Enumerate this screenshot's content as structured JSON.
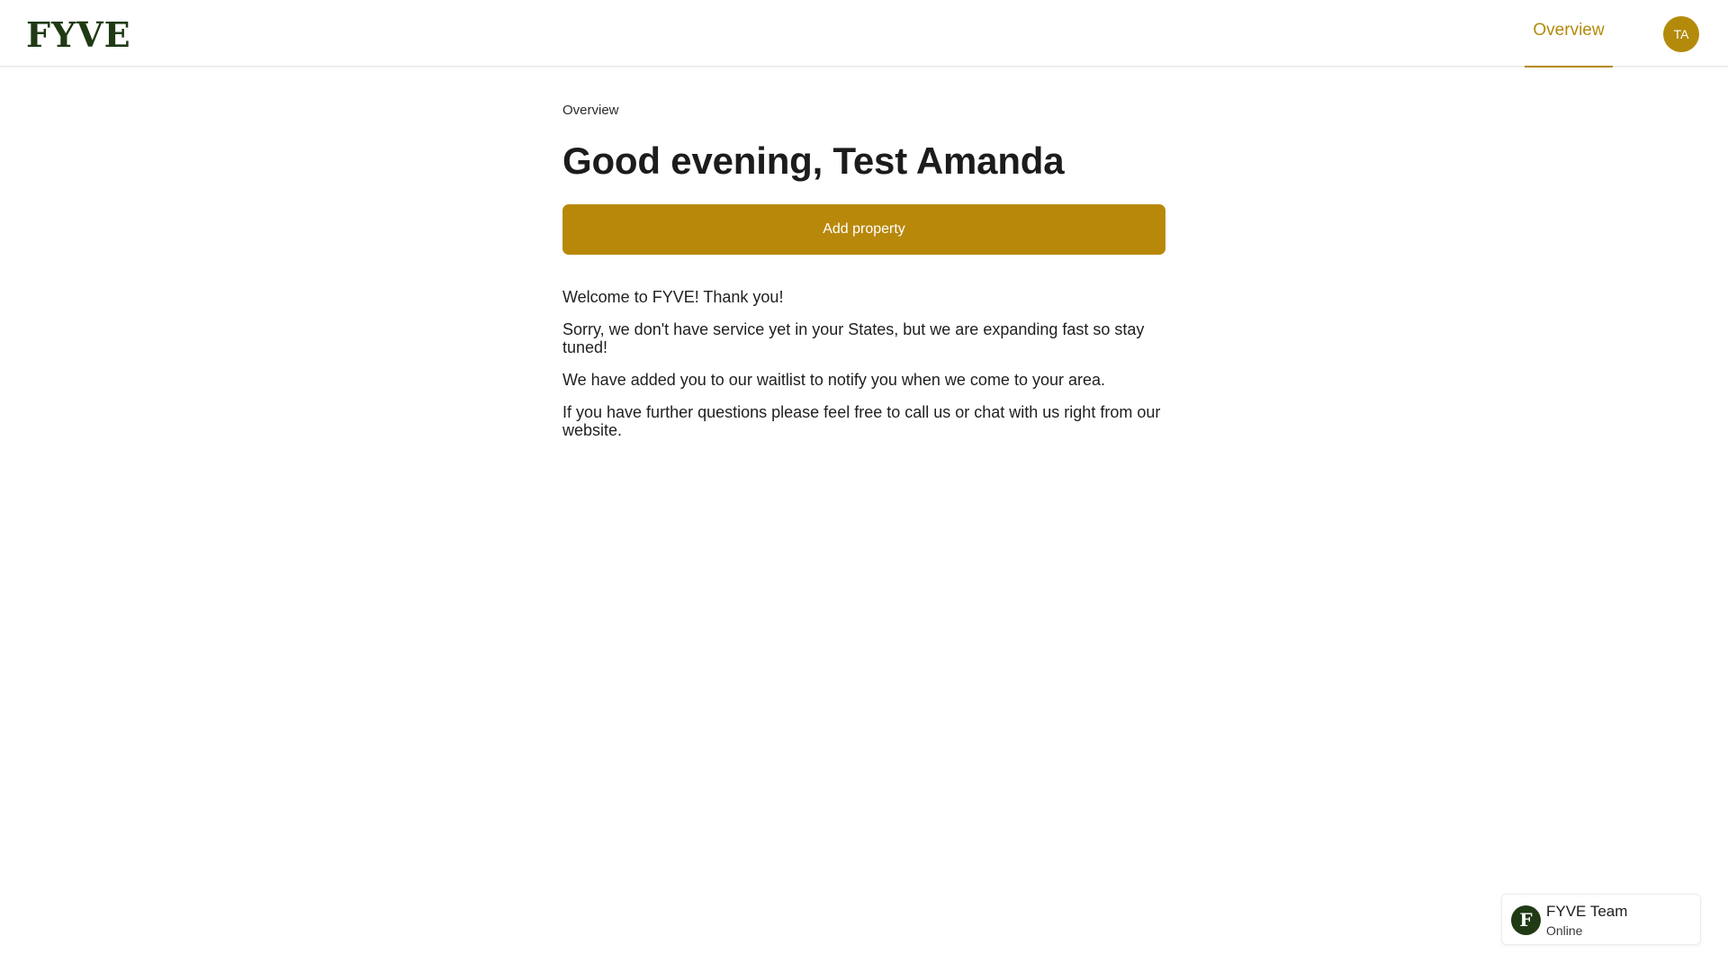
{
  "header": {
    "logo_text": "FYVE",
    "nav": [
      {
        "label": "Overview",
        "active": true
      }
    ],
    "avatar_initials": "TA"
  },
  "main": {
    "breadcrumb": "Overview",
    "title": "Good evening, Test Amanda",
    "add_property_label": "Add property",
    "messages": [
      "Welcome to FYVE! Thank you!",
      "Sorry, we don't have service yet in your States, but we are expanding fast so stay tuned!",
      "We have added you to our waitlist to notify you when we come to your area.",
      "If you have further questions please feel free to call us or chat with us right from our website."
    ]
  },
  "chat": {
    "avatar_letter": "F",
    "name": "FYVE Team",
    "status": "Online"
  },
  "colors": {
    "accent": "#b8880b",
    "brand_dark": "#1f3a14"
  }
}
